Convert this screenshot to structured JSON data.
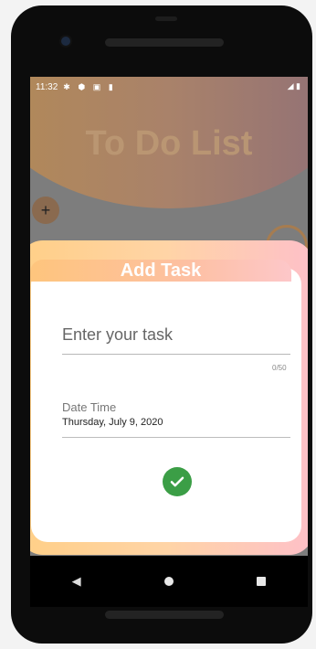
{
  "status_bar": {
    "time": "11:32",
    "icons": [
      "gear-icon",
      "shield-icon",
      "box-icon",
      "sd-card-icon"
    ],
    "right_icons": [
      "signal-icon",
      "battery-icon"
    ]
  },
  "app": {
    "title": "To Do List",
    "fab_symbol": "+"
  },
  "dialog": {
    "title": "Add Task",
    "task_input": {
      "placeholder": "Enter your task",
      "value": ""
    },
    "counter": "0/50",
    "date_label": "Date Time",
    "date_value": "Thursday, July 9, 2020",
    "confirm_icon": "check-icon"
  },
  "navigation": {
    "back": "◀",
    "home": "home-icon",
    "recents": "recents-icon"
  },
  "colors": {
    "accent_orange": "#ffcf87",
    "accent_pink": "#fec0c8",
    "confirm_green": "#3b9e46"
  }
}
